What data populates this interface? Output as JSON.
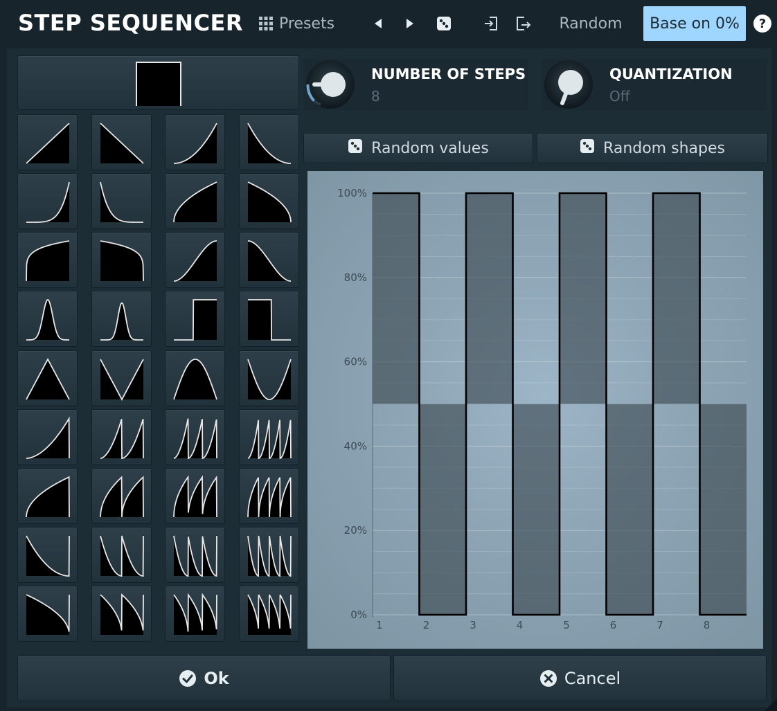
{
  "window": {
    "title": "STEP SEQUENCER"
  },
  "toolbar": {
    "presets_label": "Presets",
    "presets_icon": "grid-icon",
    "prev_icon": "triangle-left-icon",
    "next_icon": "triangle-right-icon",
    "dice_icon": "dice-icon",
    "import_icon": "import-icon",
    "export_icon": "export-icon",
    "random_label": "Random",
    "base_label": "Base on 0%",
    "help_label": "?"
  },
  "knobs": {
    "steps": {
      "title": "NUMBER OF STEPS",
      "value": "8"
    },
    "quantization": {
      "title": "QUANTIZATION",
      "value": "Off"
    }
  },
  "random_buttons": {
    "values_label": "Random values",
    "shapes_label": "Random shapes"
  },
  "shapes": {
    "count": 37,
    "names": [
      "square",
      "ramp-up",
      "ramp-down",
      "exp-up",
      "exp-down",
      "steep-exp-up",
      "steep-exp-down",
      "log-up",
      "log-down",
      "round-up",
      "round-down",
      "s-up",
      "s-down",
      "bell",
      "narrow-bell",
      "pulse-up",
      "pulse-down",
      "triangle",
      "v",
      "hill",
      "valley",
      "saw-1",
      "saw-2",
      "saw-3",
      "saw-4",
      "arc-1",
      "arc-2",
      "arc-3",
      "arc-4",
      "decay-1",
      "decay-2",
      "decay-3",
      "decay-4",
      "rdecay-1",
      "rdecay-2",
      "rdecay-3",
      "rdecay-4"
    ]
  },
  "chart_data": {
    "type": "bar",
    "categories": [
      "1",
      "2",
      "3",
      "4",
      "5",
      "6",
      "7",
      "8"
    ],
    "values": [
      100,
      0,
      100,
      0,
      100,
      0,
      100,
      0
    ],
    "base": 50,
    "ylim": [
      0,
      100
    ],
    "yticks": [
      "0%",
      "20%",
      "40%",
      "60%",
      "80%",
      "100%"
    ],
    "xticks": [
      "1",
      "2",
      "3",
      "4",
      "5",
      "6",
      "7",
      "8"
    ]
  },
  "buttons": {
    "ok_label": "Ok",
    "cancel_label": "Cancel"
  },
  "colors": {
    "accent": "#9fd6ff",
    "background": "#17242c",
    "panel": "#1d2d36",
    "bar_fill": "#4a5860",
    "graph_bg": "#8da5b5"
  }
}
